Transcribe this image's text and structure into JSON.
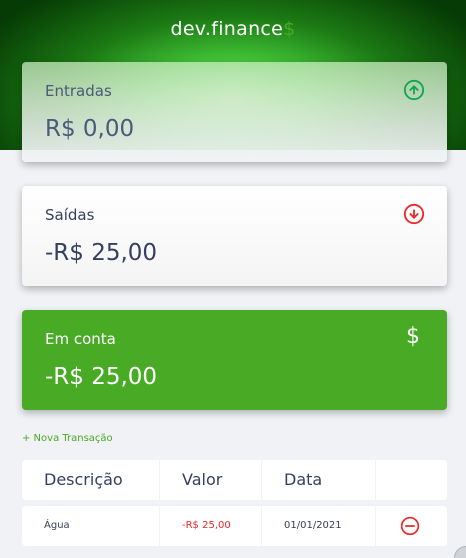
{
  "app": {
    "logo_text": "dev.finance",
    "logo_symbol": "$"
  },
  "colors": {
    "accent": "#49aa26",
    "expense": "#e92929",
    "income_icon": "#12a454",
    "text": "#363f5f"
  },
  "cards": {
    "income": {
      "label": "Entradas",
      "value": "R$ 0,00",
      "icon": "arrow-up-circle-icon"
    },
    "expense": {
      "label": "Saídas",
      "value": "-R$ 25,00",
      "icon": "arrow-down-circle-icon"
    },
    "total": {
      "label": "Em conta",
      "value": "-R$ 25,00",
      "icon": "dollar-icon",
      "symbol": "$"
    }
  },
  "new_transaction_label": "+ Nova Transação",
  "table": {
    "headers": [
      "Descrição",
      "Valor",
      "Data",
      ""
    ],
    "rows": [
      {
        "description": "Água",
        "amount": "-R$ 25,00",
        "date": "01/01/2021",
        "action_icon": "minus-circle-icon"
      }
    ]
  }
}
